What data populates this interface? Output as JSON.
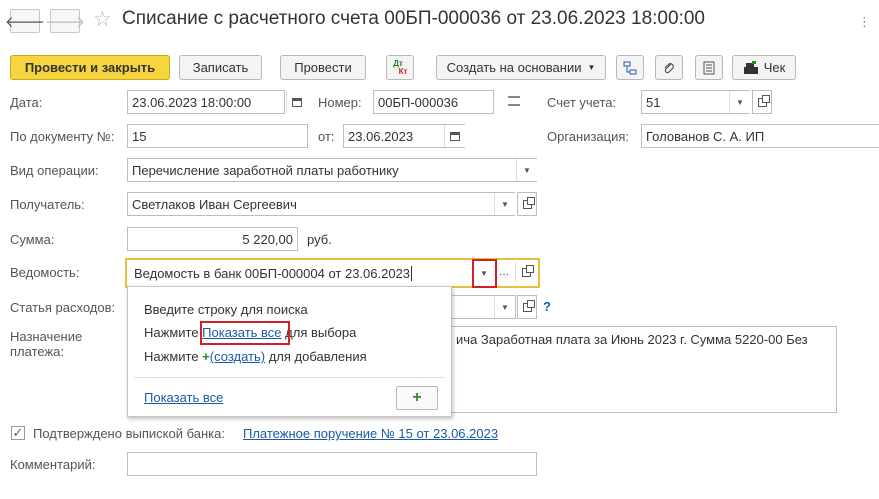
{
  "window": {
    "title": "Списание с расчетного счета 00БП-000036 от 23.06.2023 18:00:00",
    "more_menu": "⋮"
  },
  "toolbar": {
    "post_and_close": "Провести и закрыть",
    "write": "Записать",
    "post": "Провести",
    "dt_kt_top": "Дт",
    "dt_kt_bottom": "Кт",
    "create_based_on": "Создать на основании",
    "check": "Чек"
  },
  "form": {
    "date_label": "Дата:",
    "date_value": "23.06.2023 18:00:00",
    "number_label": "Номер:",
    "number_value": "00БП-000036",
    "account_label": "Счет учета:",
    "account_value": "51",
    "doc_number_label": "По документу №:",
    "doc_number_value": "15",
    "from_label": "от:",
    "from_value": "23.06.2023",
    "org_label": "Организация:",
    "org_value": "Голованов С. А. ИП",
    "operation_label": "Вид операции:",
    "operation_value": "Перечисление заработной платы работнику",
    "recipient_label": "Получатель:",
    "recipient_value": "Светлаков Иван Сергеевич",
    "sum_label": "Сумма:",
    "sum_value": "5 220,00",
    "currency": "руб.",
    "statement_label": "Ведомость:",
    "statement_value": "Ведомость в банк 00БП-000004 от 23.06.2023",
    "expense_label": "Статья расходов:",
    "help": "?",
    "purpose_label_1": "Назначение",
    "purpose_label_2": "платежа:",
    "purpose_value": "ича Заработная плата за Июнь 2023 г. Сумма 5220-00 Без",
    "confirmed_label": "Подтверждено выпиской банка:",
    "confirmed_link": "Платежное поручение № 15 от 23.06.2023",
    "comment_label": "Комментарий:",
    "comment_value": ""
  },
  "popup": {
    "line1": "Введите строку для поиска",
    "line2_prefix": "Нажмите ",
    "line2_link": "Показать все",
    "line2_suffix": " для выбора",
    "line3_prefix": "Нажмите ",
    "line3_link": "(создать)",
    "line3_suffix": " для добавления",
    "show_all": "Показать все",
    "add": "+"
  }
}
